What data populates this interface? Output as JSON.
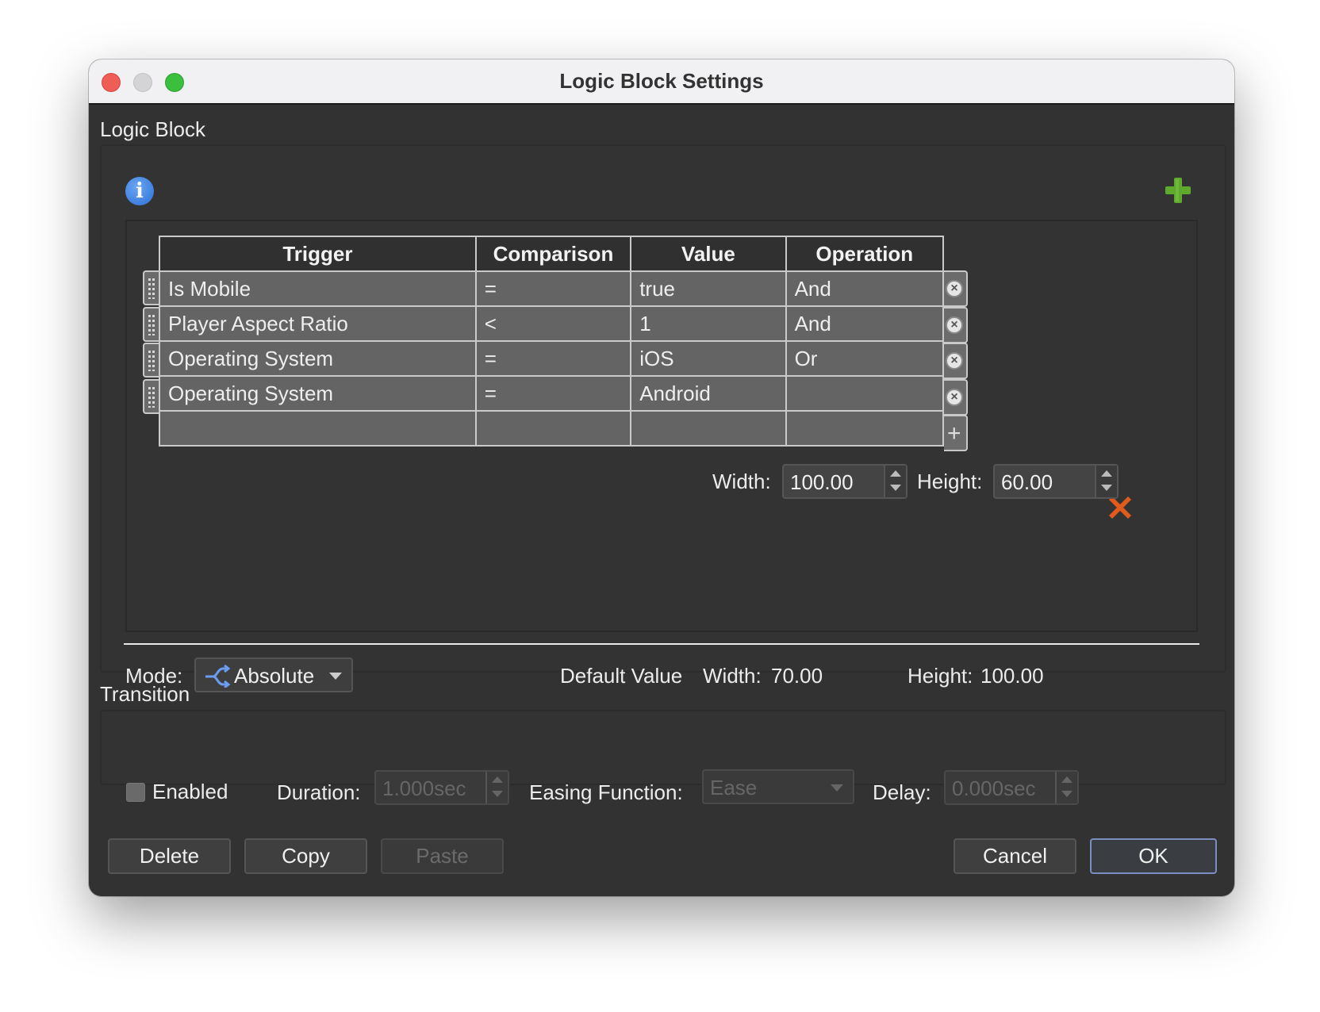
{
  "window": {
    "title": "Logic Block Settings"
  },
  "logic_block": {
    "section_label": "Logic Block",
    "table": {
      "headers": [
        "Trigger",
        "Comparison",
        "Value",
        "Operation"
      ],
      "rows": [
        [
          "Is Mobile",
          "=",
          "true",
          "And"
        ],
        [
          "Player Aspect Ratio",
          "<",
          "1",
          "And"
        ],
        [
          "Operating System",
          "=",
          "iOS",
          "Or"
        ],
        [
          "Operating System",
          "=",
          "Android",
          ""
        ]
      ]
    },
    "size": {
      "width_label": "Width:",
      "width_value": "100.00",
      "height_label": "Height:",
      "height_value": "60.00"
    },
    "mode": {
      "label": "Mode:",
      "value": "Absolute"
    },
    "default_value": {
      "label": "Default Value",
      "width_label": "Width:",
      "width_value": "70.00",
      "height_label": "Height:",
      "height_value": "100.00"
    }
  },
  "transition": {
    "section_label": "Transition",
    "enabled_label": "Enabled",
    "enabled": false,
    "duration_label": "Duration:",
    "duration_value": "1.000sec",
    "easing_label": "Easing Function:",
    "easing_value": "Ease",
    "delay_label": "Delay:",
    "delay_value": "0.000sec"
  },
  "buttons": {
    "delete": "Delete",
    "copy": "Copy",
    "paste": "Paste",
    "cancel": "Cancel",
    "ok": "OK"
  },
  "colors": {
    "window_bg": "#323232",
    "add_icon": "#5fa92c",
    "remove_icon": "#e25a1c",
    "info_icon": "#2d6fd5",
    "ok_border": "#7a8fbf"
  },
  "icons": [
    "info-icon",
    "add-plus-icon",
    "remove-x-icon",
    "drag-handle-icon",
    "circle-x-icon",
    "plus-icon",
    "mode-absolute-icon",
    "chevron-down-icon"
  ]
}
